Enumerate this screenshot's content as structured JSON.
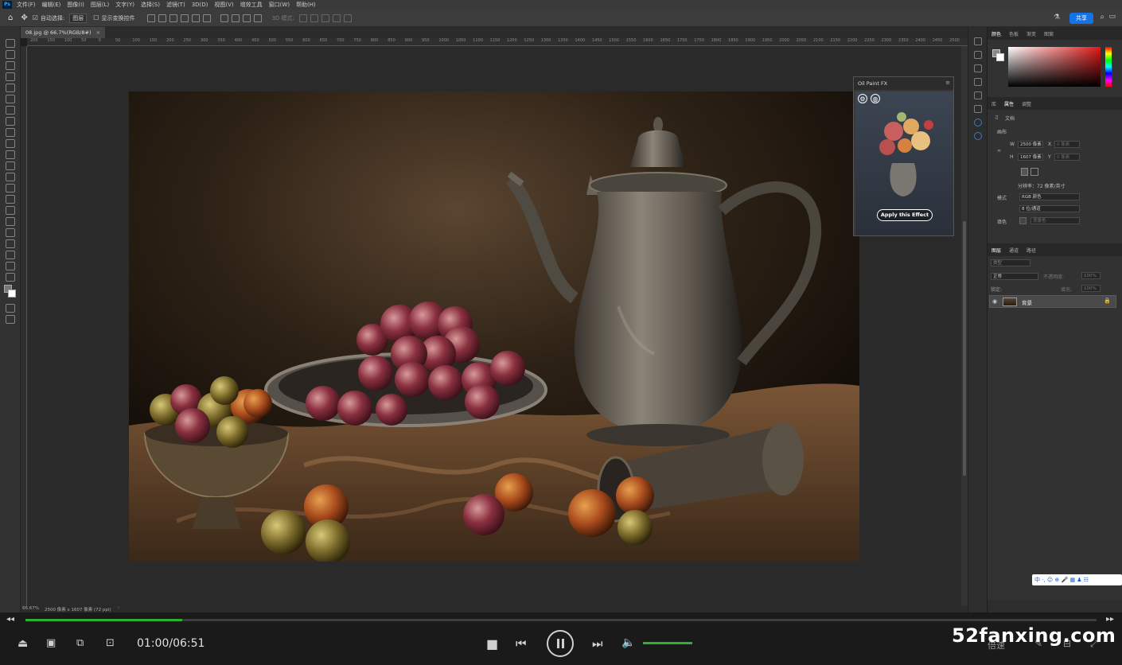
{
  "menubar": {
    "items": [
      "文件(F)",
      "编辑(E)",
      "图像(I)",
      "图层(L)",
      "文字(Y)",
      "选择(S)",
      "滤镜(T)",
      "3D(D)",
      "视图(V)",
      "增效工具",
      "窗口(W)",
      "帮助(H)"
    ]
  },
  "options": {
    "auto_select_label": "自动选择:",
    "auto_select_value": "图层",
    "show_transform_label": "显示变换控件",
    "mode_3d_label": "3D 模式:",
    "share_label": "共享"
  },
  "document": {
    "tab_title": "08.jpg @ 66.7%(RGB/8#)",
    "status_zoom": "66.67%",
    "status_info": "2500 像素 x 1607 像素 (72 ppi)"
  },
  "ruler": {
    "marks": [
      "200",
      "150",
      "100",
      "50",
      "0",
      "50",
      "100",
      "150",
      "200",
      "250",
      "300",
      "350",
      "400",
      "450",
      "500",
      "550",
      "600",
      "650",
      "700",
      "750",
      "800",
      "850",
      "900",
      "950",
      "1000",
      "1050",
      "1100",
      "1150",
      "1200",
      "1250",
      "1300",
      "1350",
      "1400",
      "1450",
      "1500",
      "1550",
      "1600",
      "1650",
      "1700",
      "1750",
      "1800",
      "1850",
      "1900",
      "1950",
      "2000",
      "2050",
      "2100",
      "2150",
      "2200",
      "2250",
      "2300",
      "2350",
      "2400",
      "2450",
      "2500"
    ]
  },
  "panel_oilpaint": {
    "title": "Oil Paint FX",
    "apply_label": "Apply this Effect"
  },
  "right_panel": {
    "color_tabs": [
      "颜色",
      "色板",
      "渐变",
      "图案"
    ],
    "prop_tabs": [
      "库",
      "属性",
      "调整"
    ],
    "doc_label": "文档",
    "canvas_label": "画布",
    "w_label": "W",
    "w_value": "2500 像素",
    "h_label": "H",
    "h_value": "1607 像素",
    "x_label": "X",
    "x_placeholder": "0 像素",
    "y_label": "Y",
    "y_placeholder": "0 像素",
    "resolution": "分辨率：72 像素/英寸",
    "mode_label": "模式",
    "mode_value": "RGB 颜色",
    "depth_value": "8 位/通道",
    "fill_label": "填色",
    "fill_value": "背景色",
    "layer_tabs": [
      "图层",
      "通道",
      "路径"
    ],
    "search_placeholder": "类型",
    "blend_mode": "正常",
    "opacity_label": "不透明度:",
    "opacity_value": "100%",
    "lock_label": "锁定:",
    "fill2_label": "填充:",
    "fill2_value": "100%",
    "layer_name": "背景"
  },
  "player": {
    "time": "01:00/06:51",
    "progress": 0.146,
    "volume": 0.6,
    "speed_label": "倍速",
    "watermark": "52fanxing.com"
  },
  "ime": {
    "text": "中 ·, ☺ ⊕ 🎤 ▦ ♟ ☷"
  }
}
